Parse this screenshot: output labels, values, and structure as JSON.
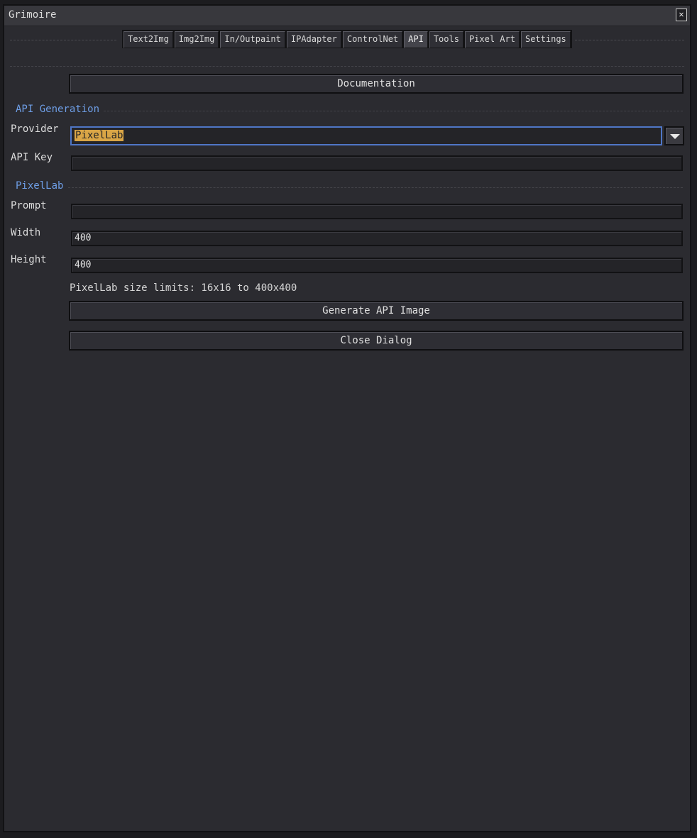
{
  "window": {
    "title": "Grimoire",
    "close_glyph": "✕"
  },
  "tabs": [
    {
      "label": "Text2Img"
    },
    {
      "label": "Img2Img"
    },
    {
      "label": "In/Outpaint"
    },
    {
      "label": "IPAdapter"
    },
    {
      "label": "ControlNet"
    },
    {
      "label": "API"
    },
    {
      "label": "Tools"
    },
    {
      "label": "Pixel Art"
    },
    {
      "label": "Settings"
    }
  ],
  "active_tab": "API",
  "documentation_button": "Documentation",
  "api_generation": {
    "section_title": "API Generation",
    "provider_label": "Provider",
    "provider_value": "PixelLab",
    "api_key_label": "API Key",
    "api_key_value": ""
  },
  "pixellab": {
    "section_title": "PixelLab",
    "prompt_label": "Prompt",
    "prompt_value": "",
    "width_label": "Width",
    "width_value": "400",
    "height_label": "Height",
    "height_value": "400",
    "size_note": "PixelLab size limits: 16x16 to 400x400"
  },
  "buttons": {
    "generate": "Generate API Image",
    "close": "Close Dialog"
  },
  "colors": {
    "accent_blue": "#6e9ee6",
    "selection": "#d9a546",
    "focus_border": "#4f76c6"
  }
}
